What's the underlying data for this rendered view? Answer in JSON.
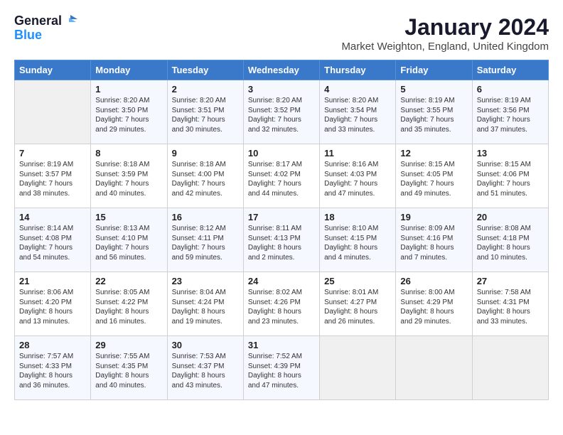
{
  "logo": {
    "line1": "General",
    "line2": "Blue"
  },
  "title": "January 2024",
  "subtitle": "Market Weighton, England, United Kingdom",
  "days_header": [
    "Sunday",
    "Monday",
    "Tuesday",
    "Wednesday",
    "Thursday",
    "Friday",
    "Saturday"
  ],
  "weeks": [
    [
      {
        "day": "",
        "content": ""
      },
      {
        "day": "1",
        "content": "Sunrise: 8:20 AM\nSunset: 3:50 PM\nDaylight: 7 hours\nand 29 minutes."
      },
      {
        "day": "2",
        "content": "Sunrise: 8:20 AM\nSunset: 3:51 PM\nDaylight: 7 hours\nand 30 minutes."
      },
      {
        "day": "3",
        "content": "Sunrise: 8:20 AM\nSunset: 3:52 PM\nDaylight: 7 hours\nand 32 minutes."
      },
      {
        "day": "4",
        "content": "Sunrise: 8:20 AM\nSunset: 3:54 PM\nDaylight: 7 hours\nand 33 minutes."
      },
      {
        "day": "5",
        "content": "Sunrise: 8:19 AM\nSunset: 3:55 PM\nDaylight: 7 hours\nand 35 minutes."
      },
      {
        "day": "6",
        "content": "Sunrise: 8:19 AM\nSunset: 3:56 PM\nDaylight: 7 hours\nand 37 minutes."
      }
    ],
    [
      {
        "day": "7",
        "content": "Sunrise: 8:19 AM\nSunset: 3:57 PM\nDaylight: 7 hours\nand 38 minutes."
      },
      {
        "day": "8",
        "content": "Sunrise: 8:18 AM\nSunset: 3:59 PM\nDaylight: 7 hours\nand 40 minutes."
      },
      {
        "day": "9",
        "content": "Sunrise: 8:18 AM\nSunset: 4:00 PM\nDaylight: 7 hours\nand 42 minutes."
      },
      {
        "day": "10",
        "content": "Sunrise: 8:17 AM\nSunset: 4:02 PM\nDaylight: 7 hours\nand 44 minutes."
      },
      {
        "day": "11",
        "content": "Sunrise: 8:16 AM\nSunset: 4:03 PM\nDaylight: 7 hours\nand 47 minutes."
      },
      {
        "day": "12",
        "content": "Sunrise: 8:15 AM\nSunset: 4:05 PM\nDaylight: 7 hours\nand 49 minutes."
      },
      {
        "day": "13",
        "content": "Sunrise: 8:15 AM\nSunset: 4:06 PM\nDaylight: 7 hours\nand 51 minutes."
      }
    ],
    [
      {
        "day": "14",
        "content": "Sunrise: 8:14 AM\nSunset: 4:08 PM\nDaylight: 7 hours\nand 54 minutes."
      },
      {
        "day": "15",
        "content": "Sunrise: 8:13 AM\nSunset: 4:10 PM\nDaylight: 7 hours\nand 56 minutes."
      },
      {
        "day": "16",
        "content": "Sunrise: 8:12 AM\nSunset: 4:11 PM\nDaylight: 7 hours\nand 59 minutes."
      },
      {
        "day": "17",
        "content": "Sunrise: 8:11 AM\nSunset: 4:13 PM\nDaylight: 8 hours\nand 2 minutes."
      },
      {
        "day": "18",
        "content": "Sunrise: 8:10 AM\nSunset: 4:15 PM\nDaylight: 8 hours\nand 4 minutes."
      },
      {
        "day": "19",
        "content": "Sunrise: 8:09 AM\nSunset: 4:16 PM\nDaylight: 8 hours\nand 7 minutes."
      },
      {
        "day": "20",
        "content": "Sunrise: 8:08 AM\nSunset: 4:18 PM\nDaylight: 8 hours\nand 10 minutes."
      }
    ],
    [
      {
        "day": "21",
        "content": "Sunrise: 8:06 AM\nSunset: 4:20 PM\nDaylight: 8 hours\nand 13 minutes."
      },
      {
        "day": "22",
        "content": "Sunrise: 8:05 AM\nSunset: 4:22 PM\nDaylight: 8 hours\nand 16 minutes."
      },
      {
        "day": "23",
        "content": "Sunrise: 8:04 AM\nSunset: 4:24 PM\nDaylight: 8 hours\nand 19 minutes."
      },
      {
        "day": "24",
        "content": "Sunrise: 8:02 AM\nSunset: 4:26 PM\nDaylight: 8 hours\nand 23 minutes."
      },
      {
        "day": "25",
        "content": "Sunrise: 8:01 AM\nSunset: 4:27 PM\nDaylight: 8 hours\nand 26 minutes."
      },
      {
        "day": "26",
        "content": "Sunrise: 8:00 AM\nSunset: 4:29 PM\nDaylight: 8 hours\nand 29 minutes."
      },
      {
        "day": "27",
        "content": "Sunrise: 7:58 AM\nSunset: 4:31 PM\nDaylight: 8 hours\nand 33 minutes."
      }
    ],
    [
      {
        "day": "28",
        "content": "Sunrise: 7:57 AM\nSunset: 4:33 PM\nDaylight: 8 hours\nand 36 minutes."
      },
      {
        "day": "29",
        "content": "Sunrise: 7:55 AM\nSunset: 4:35 PM\nDaylight: 8 hours\nand 40 minutes."
      },
      {
        "day": "30",
        "content": "Sunrise: 7:53 AM\nSunset: 4:37 PM\nDaylight: 8 hours\nand 43 minutes."
      },
      {
        "day": "31",
        "content": "Sunrise: 7:52 AM\nSunset: 4:39 PM\nDaylight: 8 hours\nand 47 minutes."
      },
      {
        "day": "",
        "content": ""
      },
      {
        "day": "",
        "content": ""
      },
      {
        "day": "",
        "content": ""
      }
    ]
  ]
}
